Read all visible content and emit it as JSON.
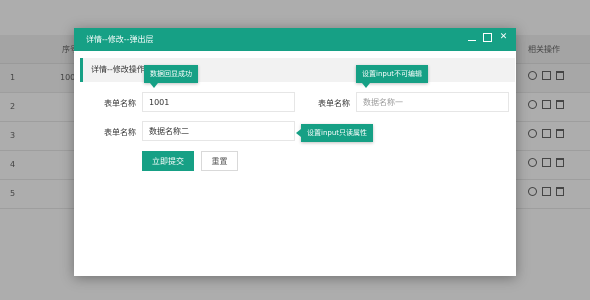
{
  "table": {
    "header": {
      "seq_label": "序号",
      "ops_label": "相关操作"
    },
    "rows": [
      {
        "num": "1",
        "seq": "1001"
      },
      {
        "num": "2",
        "seq": ""
      },
      {
        "num": "3",
        "seq": ""
      },
      {
        "num": "4",
        "seq": ""
      },
      {
        "num": "5",
        "seq": ""
      }
    ]
  },
  "dialog": {
    "title": "详情--修改--弹出层",
    "window_controls": {
      "minimize": "minimize-icon",
      "maximize": "maximize-icon",
      "close": "close-icon",
      "close_glyph": "✕"
    },
    "legend": "详情--修改操作",
    "tooltips": {
      "data_echo": "数据回显成功",
      "input_readonly": "设置input不可编辑",
      "input_readonly_attr": "设置input只读属性"
    },
    "form": {
      "field1_label": "表单名称",
      "field1_value": "1001",
      "field2_label": "表单名称",
      "field2_placeholder": "数据名称一",
      "field3_label": "表单名称",
      "field3_value": "数据名称二",
      "submit_label": "立即提交",
      "reset_label": "重置"
    }
  },
  "colors": {
    "accent": "#16a085"
  }
}
